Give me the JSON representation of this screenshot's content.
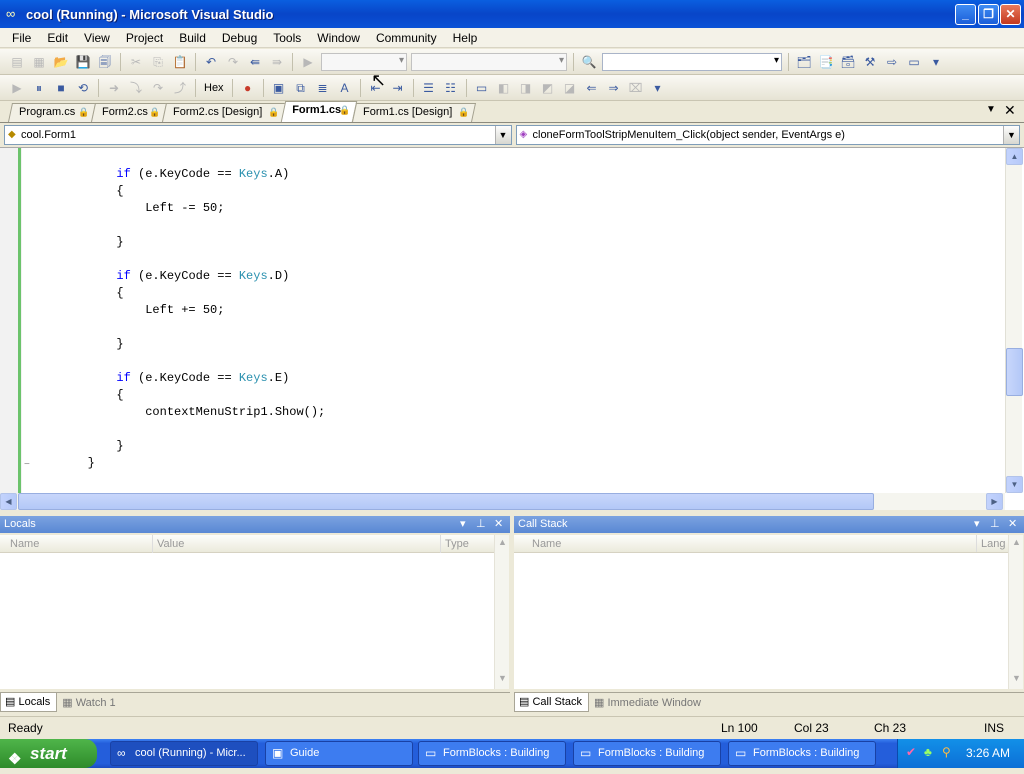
{
  "window": {
    "title": "cool (Running) - Microsoft Visual Studio"
  },
  "menu": [
    "File",
    "Edit",
    "View",
    "Project",
    "Build",
    "Debug",
    "Tools",
    "Window",
    "Community",
    "Help"
  ],
  "debug_toolbar": {
    "hex_label": "Hex"
  },
  "tabs": [
    {
      "label": "Program.cs",
      "active": false
    },
    {
      "label": "Form2.cs",
      "active": false
    },
    {
      "label": "Form2.cs [Design]",
      "active": false
    },
    {
      "label": "Form1.cs",
      "active": true
    },
    {
      "label": "Form1.cs [Design]",
      "active": false
    }
  ],
  "navbar": {
    "class_combo": "cool.Form1",
    "member_combo": "cloneFormToolStripMenuItem_Click(object sender, EventArgs e)"
  },
  "code_lines": [
    "            if (e.KeyCode == Keys.A)",
    "            {",
    "                Left -= 50;",
    "",
    "            }",
    "",
    "            if (e.KeyCode == Keys.D)",
    "            {",
    "                Left += 50;",
    "",
    "            }",
    "",
    "            if (e.KeyCode == Keys.E)",
    "            {",
    "                contextMenuStrip1.Show();",
    "",
    "            }",
    "        }"
  ],
  "locals_panel": {
    "title": "Locals",
    "columns": [
      "Name",
      "Value",
      "Type"
    ],
    "tabs": [
      "Locals",
      "Watch 1"
    ]
  },
  "callstack_panel": {
    "title": "Call Stack",
    "columns": [
      "Name",
      "Lang"
    ],
    "tabs": [
      "Call Stack",
      "Immediate Window"
    ]
  },
  "status": {
    "text": "Ready",
    "ln": "Ln 100",
    "col": "Col 23",
    "ch": "Ch 23",
    "mode": "INS"
  },
  "taskbar": {
    "start": "start",
    "tasks": [
      "cool (Running) - Micr...",
      "Guide",
      "FormBlocks : Building",
      "FormBlocks : Building",
      "FormBlocks : Building"
    ],
    "clock": "3:26 AM"
  }
}
